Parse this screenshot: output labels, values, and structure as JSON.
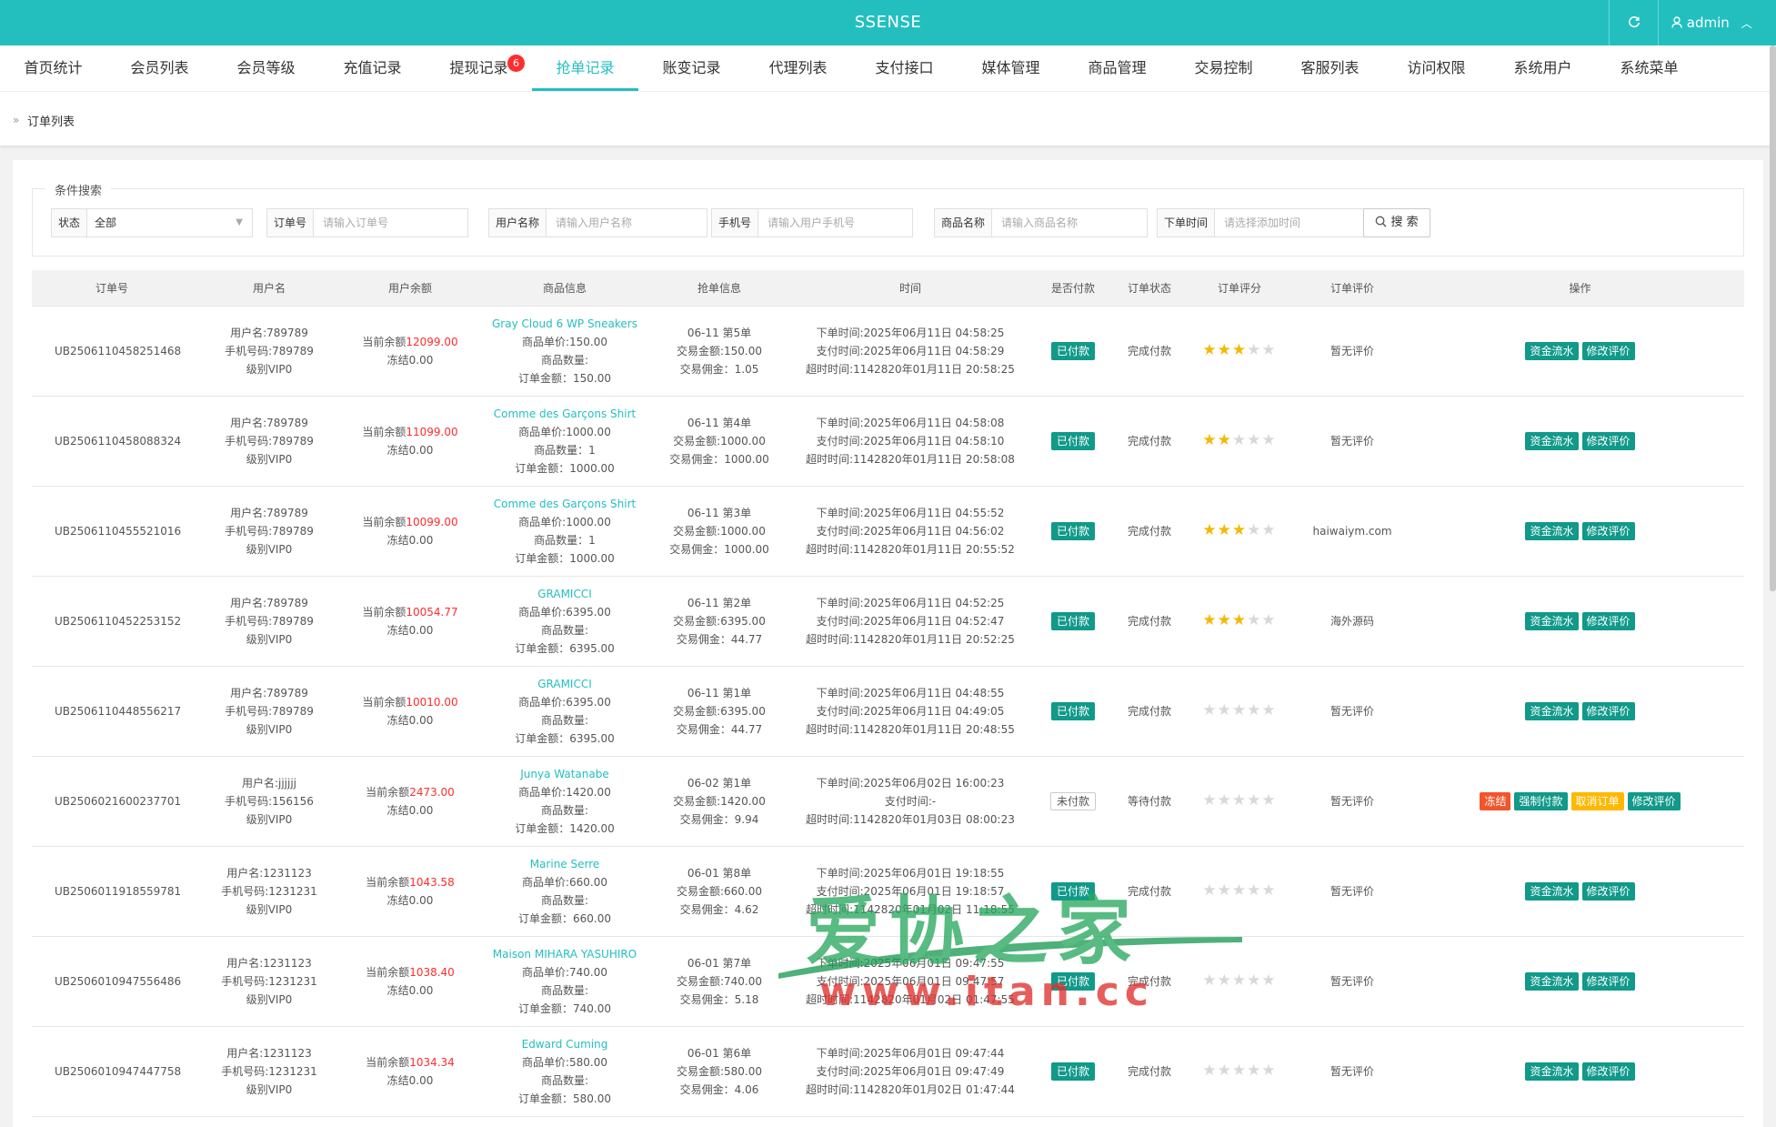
{
  "app": {
    "title": "SSENSE",
    "user": "admin",
    "refresh_icon": "refresh-icon",
    "user_icon": "user-icon"
  },
  "nav": {
    "items": [
      {
        "label": "首页统计"
      },
      {
        "label": "会员列表"
      },
      {
        "label": "会员等级"
      },
      {
        "label": "充值记录"
      },
      {
        "label": "提现记录",
        "badge": "6"
      },
      {
        "label": "抢单记录",
        "active": true
      },
      {
        "label": "账变记录"
      },
      {
        "label": "代理列表"
      },
      {
        "label": "支付接口"
      },
      {
        "label": "媒体管理"
      },
      {
        "label": "商品管理"
      },
      {
        "label": "交易控制"
      },
      {
        "label": "客服列表"
      },
      {
        "label": "访问权限"
      },
      {
        "label": "系统用户"
      },
      {
        "label": "系统菜单"
      }
    ]
  },
  "breadcrumb": {
    "current": "订单列表"
  },
  "search": {
    "legend": "条件搜索",
    "status_label": "状态",
    "status_value": "全部",
    "order_label": "订单号",
    "order_placeholder": "请输入订单号",
    "username_label": "用户名称",
    "username_placeholder": "请输入用户名称",
    "phone_label": "手机号",
    "phone_placeholder": "请输入用户手机号",
    "product_label": "商品名称",
    "product_placeholder": "请输入商品名称",
    "time_label": "下单时间",
    "time_placeholder": "请选择添加时间",
    "button": "搜 索"
  },
  "table": {
    "headers": [
      "订单号",
      "用户名",
      "用户余额",
      "商品信息",
      "抢单信息",
      "时间",
      "是否付款",
      "订单状态",
      "订单评分",
      "订单评价",
      "操作"
    ],
    "rows": [
      {
        "id": "UB2506110458251468",
        "user": "用户名:789789",
        "phone": "手机号码:789789",
        "level": "级别VIP0",
        "bal_label": "当前余额",
        "balance": "12099.00",
        "frozen": "冻结0.00",
        "product": "Gray Cloud 6 WP Sneakers",
        "price": "商品单价:150.00",
        "qty": "商品数量:",
        "total": "订单金额：150.00",
        "grab": "06-11 第5单",
        "amount": "交易金额:150.00",
        "commission": "交易佣金：1.05",
        "placed": "下单时间:2025年06月11日 04:58:25",
        "paid_time": "支付时间:2025年06月11日 04:58:29",
        "timeout": "超时时间:1142820年01月11日 20:58:25",
        "pay": "已付款",
        "paid": true,
        "status": "完成付款",
        "stars": 3,
        "review": "暂无评价",
        "actions": [
          {
            "label": "资金流水",
            "color": "green"
          },
          {
            "label": "修改评价",
            "color": "green"
          }
        ]
      },
      {
        "id": "UB2506110458088324",
        "user": "用户名:789789",
        "phone": "手机号码:789789",
        "level": "级别VIP0",
        "bal_label": "当前余额",
        "balance": "11099.00",
        "frozen": "冻结0.00",
        "product": "Comme des Garçons Shirt",
        "price": "商品单价:1000.00",
        "qty": "商品数量：1",
        "total": "订单金额：1000.00",
        "grab": "06-11 第4单",
        "amount": "交易金额:1000.00",
        "commission": "交易佣金：1000.00",
        "placed": "下单时间:2025年06月11日 04:58:08",
        "paid_time": "支付时间:2025年06月11日 04:58:10",
        "timeout": "超时时间:1142820年01月11日 20:58:08",
        "pay": "已付款",
        "paid": true,
        "status": "完成付款",
        "stars": 2,
        "review": "暂无评价",
        "actions": [
          {
            "label": "资金流水",
            "color": "green"
          },
          {
            "label": "修改评价",
            "color": "green"
          }
        ]
      },
      {
        "id": "UB2506110455521016",
        "user": "用户名:789789",
        "phone": "手机号码:789789",
        "level": "级别VIP0",
        "bal_label": "当前余额",
        "balance": "10099.00",
        "frozen": "冻结0.00",
        "product": "Comme des Garçons Shirt",
        "price": "商品单价:1000.00",
        "qty": "商品数量：1",
        "total": "订单金额：1000.00",
        "grab": "06-11 第3单",
        "amount": "交易金额:1000.00",
        "commission": "交易佣金：1000.00",
        "placed": "下单时间:2025年06月11日 04:55:52",
        "paid_time": "支付时间:2025年06月11日 04:56:02",
        "timeout": "超时时间:1142820年01月11日 20:55:52",
        "pay": "已付款",
        "paid": true,
        "status": "完成付款",
        "stars": 3,
        "review": "haiwaiym.com",
        "actions": [
          {
            "label": "资金流水",
            "color": "green"
          },
          {
            "label": "修改评价",
            "color": "green"
          }
        ]
      },
      {
        "id": "UB2506110452253152",
        "user": "用户名:789789",
        "phone": "手机号码:789789",
        "level": "级别VIP0",
        "bal_label": "当前余额",
        "balance": "10054.77",
        "frozen": "冻结0.00",
        "product": "GRAMICCI",
        "price": "商品单价:6395.00",
        "qty": "商品数量:",
        "total": "订单金额：6395.00",
        "grab": "06-11 第2单",
        "amount": "交易金额:6395.00",
        "commission": "交易佣金：44.77",
        "placed": "下单时间:2025年06月11日 04:52:25",
        "paid_time": "支付时间:2025年06月11日 04:52:47",
        "timeout": "超时时间:1142820年01月11日 20:52:25",
        "pay": "已付款",
        "paid": true,
        "status": "完成付款",
        "stars": 3,
        "review": "海外源码",
        "actions": [
          {
            "label": "资金流水",
            "color": "green"
          },
          {
            "label": "修改评价",
            "color": "green"
          }
        ]
      },
      {
        "id": "UB2506110448556217",
        "user": "用户名:789789",
        "phone": "手机号码:789789",
        "level": "级别VIP0",
        "bal_label": "当前余额",
        "balance": "10010.00",
        "frozen": "冻结0.00",
        "product": "GRAMICCI",
        "price": "商品单价:6395.00",
        "qty": "商品数量:",
        "total": "订单金额：6395.00",
        "grab": "06-11 第1单",
        "amount": "交易金额:6395.00",
        "commission": "交易佣金：44.77",
        "placed": "下单时间:2025年06月11日 04:48:55",
        "paid_time": "支付时间:2025年06月11日 04:49:05",
        "timeout": "超时时间:1142820年01月11日 20:48:55",
        "pay": "已付款",
        "paid": true,
        "status": "完成付款",
        "stars": 0,
        "review": "暂无评价",
        "actions": [
          {
            "label": "资金流水",
            "color": "green"
          },
          {
            "label": "修改评价",
            "color": "green"
          }
        ]
      },
      {
        "id": "UB2506021600237701",
        "user": "用户名:jjjjjj",
        "phone": "手机号码:156156",
        "level": "级别VIP0",
        "bal_label": "当前余额",
        "balance": "2473.00",
        "frozen": "冻结0.00",
        "product": "Junya Watanabe",
        "price": "商品单价:1420.00",
        "qty": "商品数量:",
        "total": "订单金额：1420.00",
        "grab": "06-02 第1单",
        "amount": "交易金额:1420.00",
        "commission": "交易佣金：9.94",
        "placed": "下单时间:2025年06月02日 16:00:23",
        "paid_time": "支付时间:-",
        "timeout": "超时时间:1142820年01月03日 08:00:23",
        "pay": "未付款",
        "paid": false,
        "status": "等待付款",
        "stars": 0,
        "review": "暂无评价",
        "actions": [
          {
            "label": "冻结",
            "color": "red"
          },
          {
            "label": "强制付款",
            "color": "green"
          },
          {
            "label": "取消订单",
            "color": "yellow"
          },
          {
            "label": "修改评价",
            "color": "green"
          }
        ]
      },
      {
        "id": "UB2506011918559781",
        "user": "用户名:1231123",
        "phone": "手机号码:1231231",
        "level": "级别VIP0",
        "bal_label": "当前余额",
        "balance": "1043.58",
        "frozen": "冻结0.00",
        "product": "Marine Serre",
        "price": "商品单价:660.00",
        "qty": "商品数量:",
        "total": "订单金额：660.00",
        "grab": "06-01 第8单",
        "amount": "交易金额:660.00",
        "commission": "交易佣金：4.62",
        "placed": "下单时间:2025年06月01日 19:18:55",
        "paid_time": "支付时间:2025年06月01日 19:18:57",
        "timeout": "超时时间:1142820年01月02日 11:18:55",
        "pay": "已付款",
        "paid": true,
        "status": "完成付款",
        "stars": 0,
        "review": "暂无评价",
        "actions": [
          {
            "label": "资金流水",
            "color": "green"
          },
          {
            "label": "修改评价",
            "color": "green"
          }
        ]
      },
      {
        "id": "UB2506010947556486",
        "user": "用户名:1231123",
        "phone": "手机号码:1231231",
        "level": "级别VIP0",
        "bal_label": "当前余额",
        "balance": "1038.40",
        "frozen": "冻结0.00",
        "product": "Maison MIHARA YASUHIRO",
        "price": "商品单价:740.00",
        "qty": "商品数量:",
        "total": "订单金额：740.00",
        "grab": "06-01 第7单",
        "amount": "交易金额:740.00",
        "commission": "交易佣金：5.18",
        "placed": "下单时间:2025年06月01日 09:47:55",
        "paid_time": "支付时间:2025年06月01日 09:47:57",
        "timeout": "超时时间:1142820年01月02日 01:47:55",
        "pay": "已付款",
        "paid": true,
        "status": "完成付款",
        "stars": 0,
        "review": "暂无评价",
        "actions": [
          {
            "label": "资金流水",
            "color": "green"
          },
          {
            "label": "修改评价",
            "color": "green"
          }
        ]
      },
      {
        "id": "UB2506010947447758",
        "user": "用户名:1231123",
        "phone": "手机号码:1231231",
        "level": "级别VIP0",
        "bal_label": "当前余额",
        "balance": "1034.34",
        "frozen": "冻结0.00",
        "product": "Edward Cuming",
        "price": "商品单价:580.00",
        "qty": "商品数量:",
        "total": "订单金额：580.00",
        "grab": "06-01 第6单",
        "amount": "交易金额:580.00",
        "commission": "交易佣金：4.06",
        "placed": "下单时间:2025年06月01日 09:47:44",
        "paid_time": "支付时间:2025年06月01日 09:47:49",
        "timeout": "超时时间:1142820年01月02日 01:47:44",
        "pay": "已付款",
        "paid": true,
        "status": "完成付款",
        "stars": 0,
        "review": "暂无评价",
        "actions": [
          {
            "label": "资金流水",
            "color": "green"
          },
          {
            "label": "修改评价",
            "color": "green"
          }
        ]
      }
    ]
  },
  "watermark": {
    "title": "爱协之家",
    "url": "www.itan.cc"
  },
  "colors": {
    "primary": "#23bfbf",
    "action_green": "#11998a",
    "danger": "#f1552c",
    "warning": "#ffb800",
    "balance_red": "#ff2d2d",
    "star": "#f5b800"
  }
}
